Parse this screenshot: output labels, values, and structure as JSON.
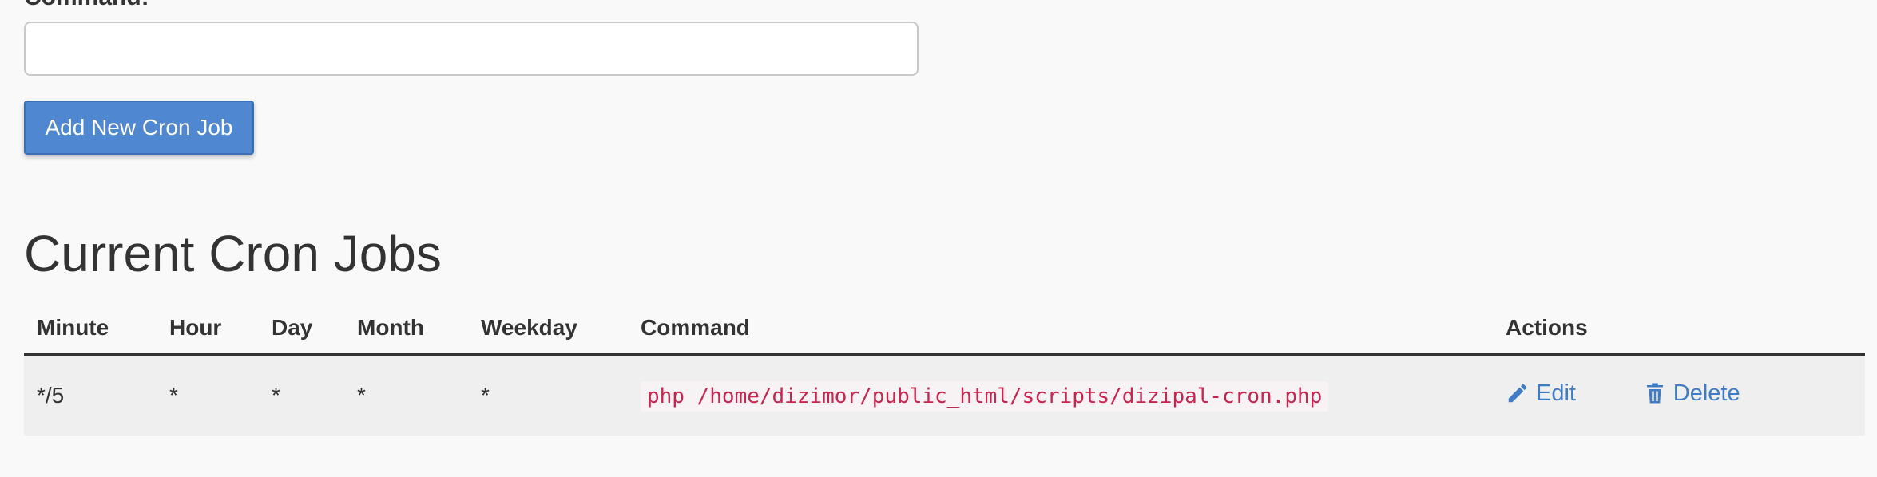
{
  "form": {
    "command_label": "Command:",
    "command_value": "",
    "add_button_label": "Add New Cron Job"
  },
  "section": {
    "title": "Current Cron Jobs"
  },
  "table": {
    "headers": {
      "minute": "Minute",
      "hour": "Hour",
      "day": "Day",
      "month": "Month",
      "weekday": "Weekday",
      "command": "Command",
      "actions": "Actions"
    },
    "rows": [
      {
        "minute": "*/5",
        "hour": "*",
        "day": "*",
        "month": "*",
        "weekday": "*",
        "command": "php /home/dizimor/public_html/scripts/dizipal-cron.php",
        "edit_label": "Edit",
        "delete_label": "Delete"
      }
    ]
  },
  "icons": {
    "edit": "pencil-icon",
    "delete": "trash-icon"
  },
  "colors": {
    "primary_button": "#4f88d1",
    "link": "#3f7cc5",
    "code_text": "#c7254e",
    "row_background": "#efefef"
  }
}
